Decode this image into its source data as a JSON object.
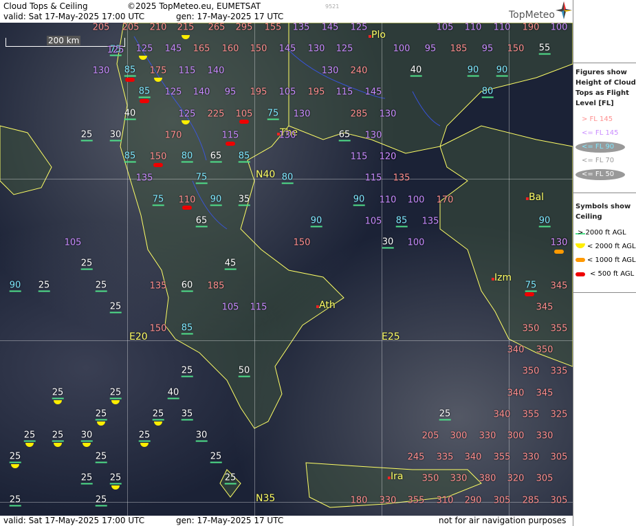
{
  "header": {
    "title": "Cloud Tops & Ceiling",
    "copyright": "©2025 TopMeteo.eu, EUMETSAT",
    "valid": "valid:  Sat  17-May-2025  17:00 UTC",
    "gen": "gen: 17-May-2025 17 UTC",
    "code": "9521",
    "logo": "TopMeteo"
  },
  "footer": {
    "valid": "valid:  Sat  17-May-2025  17:00 UTC",
    "gen": "gen: 17-May-2025 17 UTC",
    "note": "not for air navigation purposes"
  },
  "scale": "200 km",
  "grid_labels": {
    "n40": "N40",
    "n35": "N35",
    "e20": "E20",
    "e25": "E25"
  },
  "cities": [
    {
      "name": "Plo"
    },
    {
      "name": "The"
    },
    {
      "name": "Bal"
    },
    {
      "name": "Izm"
    },
    {
      "name": "Ath"
    },
    {
      "name": "Ira"
    }
  ],
  "legend": {
    "figures_title": [
      "Figures show",
      "Height of Cloud",
      "Tops as Flight",
      "Level  [FL]"
    ],
    "items": [
      {
        "label": "> FL 145",
        "color": "#ff8f8f"
      },
      {
        "label": "<= FL 145",
        "color": "#c98cff"
      },
      {
        "label": "<= FL 90",
        "color": "#7fe8ff"
      },
      {
        "label": "<= FL 70",
        "color": "#ffffff"
      },
      {
        "label": "<= FL 50",
        "color": "#ffffff"
      }
    ],
    "symbols_title": [
      "Symbols show",
      "Ceiling"
    ],
    "symbols": [
      {
        "label": "> 2000 ft AGL",
        "color": "#4fe08a"
      },
      {
        "label": "< 2000 ft AGL",
        "color": "#ffee00"
      },
      {
        "label": "< 1000 ft AGL",
        "color": "#ff9900"
      },
      {
        "label": "< 500 ft AGL",
        "color": "#ee0000"
      }
    ]
  },
  "labels": [
    {
      "t": "205",
      "c": "hi"
    },
    {
      "t": "205",
      "c": "hi"
    },
    {
      "t": "210",
      "c": "hi"
    },
    {
      "t": "215",
      "c": "hi"
    },
    {
      "t": "265",
      "c": "hi"
    },
    {
      "t": "295",
      "c": "hi"
    },
    {
      "t": "155",
      "c": "hi"
    },
    {
      "t": "135",
      "c": "mid"
    },
    {
      "t": "145",
      "c": "mid"
    },
    {
      "t": "125",
      "c": "mid"
    },
    {
      "t": "105",
      "c": "mid"
    },
    {
      "t": "110",
      "c": "mid"
    },
    {
      "t": "110",
      "c": "mid"
    },
    {
      "t": "190",
      "c": "hi"
    },
    {
      "t": "100",
      "c": "mid"
    },
    {
      "t": "75",
      "c": "low"
    },
    {
      "t": "125",
      "c": "mid"
    },
    {
      "t": "145",
      "c": "mid"
    },
    {
      "t": "165",
      "c": "hi"
    },
    {
      "t": "160",
      "c": "hi"
    },
    {
      "t": "150",
      "c": "hi"
    },
    {
      "t": "145",
      "c": "mid"
    },
    {
      "t": "130",
      "c": "mid"
    },
    {
      "t": "125",
      "c": "mid"
    },
    {
      "t": "100",
      "c": "mid"
    },
    {
      "t": "95",
      "c": "mid"
    },
    {
      "t": "185",
      "c": "hi"
    },
    {
      "t": "95",
      "c": "mid"
    },
    {
      "t": "150",
      "c": "hi"
    },
    {
      "t": "55",
      "c": "vlow"
    },
    {
      "t": "130",
      "c": "mid"
    },
    {
      "t": "85",
      "c": "low"
    },
    {
      "t": "175",
      "c": "hi"
    },
    {
      "t": "115",
      "c": "mid"
    },
    {
      "t": "140",
      "c": "mid"
    },
    {
      "t": "130",
      "c": "mid"
    },
    {
      "t": "240",
      "c": "hi"
    },
    {
      "t": "40",
      "c": "vlow"
    },
    {
      "t": "90",
      "c": "low"
    },
    {
      "t": "90",
      "c": "low"
    },
    {
      "t": "85",
      "c": "low"
    },
    {
      "t": "125",
      "c": "mid"
    },
    {
      "t": "140",
      "c": "mid"
    },
    {
      "t": "95",
      "c": "mid"
    },
    {
      "t": "195",
      "c": "hi"
    },
    {
      "t": "105",
      "c": "mid"
    },
    {
      "t": "195",
      "c": "hi"
    },
    {
      "t": "115",
      "c": "mid"
    },
    {
      "t": "145",
      "c": "mid"
    },
    {
      "t": "80",
      "c": "low"
    },
    {
      "t": "40",
      "c": "vlow"
    },
    {
      "t": "125",
      "c": "mid"
    },
    {
      "t": "225",
      "c": "hi"
    },
    {
      "t": "105",
      "c": "hi"
    },
    {
      "t": "75",
      "c": "low"
    },
    {
      "t": "130",
      "c": "mid"
    },
    {
      "t": "285",
      "c": "hi"
    },
    {
      "t": "130",
      "c": "mid"
    },
    {
      "t": "25",
      "c": "vlow"
    },
    {
      "t": "30",
      "c": "vlow"
    },
    {
      "t": "170",
      "c": "hi"
    },
    {
      "t": "115",
      "c": "mid"
    },
    {
      "t": "130",
      "c": "mid"
    },
    {
      "t": "65",
      "c": "vlow"
    },
    {
      "t": "130",
      "c": "mid"
    },
    {
      "t": "85",
      "c": "low"
    },
    {
      "t": "150",
      "c": "hi"
    },
    {
      "t": "80",
      "c": "low"
    },
    {
      "t": "65",
      "c": "vlow"
    },
    {
      "t": "85",
      "c": "low"
    },
    {
      "t": "115",
      "c": "mid"
    },
    {
      "t": "120",
      "c": "mid"
    },
    {
      "t": "135",
      "c": "mid"
    },
    {
      "t": "75",
      "c": "low"
    },
    {
      "t": "80",
      "c": "low"
    },
    {
      "t": "115",
      "c": "mid"
    },
    {
      "t": "135",
      "c": "hi"
    },
    {
      "t": "75",
      "c": "low"
    },
    {
      "t": "110",
      "c": "hi"
    },
    {
      "t": "90",
      "c": "low"
    },
    {
      "t": "35",
      "c": "vlow"
    },
    {
      "t": "90",
      "c": "low"
    },
    {
      "t": "110",
      "c": "mid"
    },
    {
      "t": "100",
      "c": "mid"
    },
    {
      "t": "170",
      "c": "hi"
    },
    {
      "t": "65",
      "c": "vlow"
    },
    {
      "t": "90",
      "c": "low"
    },
    {
      "t": "105",
      "c": "mid"
    },
    {
      "t": "85",
      "c": "low"
    },
    {
      "t": "135",
      "c": "mid"
    },
    {
      "t": "90",
      "c": "low"
    },
    {
      "t": "105",
      "c": "mid"
    },
    {
      "t": "150",
      "c": "hi"
    },
    {
      "t": "30",
      "c": "vlow"
    },
    {
      "t": "100",
      "c": "mid"
    },
    {
      "t": "130",
      "c": "hi"
    },
    {
      "t": "25",
      "c": "vlow"
    },
    {
      "t": "45",
      "c": "vlow"
    },
    {
      "t": "90",
      "c": "low"
    },
    {
      "t": "25",
      "c": "vlow"
    },
    {
      "t": "25",
      "c": "vlow"
    },
    {
      "t": "135",
      "c": "hi"
    },
    {
      "t": "60",
      "c": "vlow"
    },
    {
      "t": "185",
      "c": "hi"
    },
    {
      "t": "75",
      "c": "low"
    },
    {
      "t": "345",
      "c": "hi"
    },
    {
      "t": "25",
      "c": "vlow"
    },
    {
      "t": "105",
      "c": "mid"
    },
    {
      "t": "115",
      "c": "mid"
    },
    {
      "t": "345",
      "c": "hi"
    },
    {
      "t": "150",
      "c": "hi"
    },
    {
      "t": "85",
      "c": "low"
    },
    {
      "t": "350",
      "c": "hi"
    },
    {
      "t": "355",
      "c": "hi"
    },
    {
      "t": "340",
      "c": "hi"
    },
    {
      "t": "350",
      "c": "hi"
    },
    {
      "t": "25",
      "c": "vlow"
    },
    {
      "t": "50",
      "c": "vlow"
    },
    {
      "t": "350",
      "c": "hi"
    },
    {
      "t": "335",
      "c": "hi"
    },
    {
      "t": "25",
      "c": "vlow"
    },
    {
      "t": "25",
      "c": "vlow"
    },
    {
      "t": "40",
      "c": "vlow"
    },
    {
      "t": "340",
      "c": "hi"
    },
    {
      "t": "345",
      "c": "hi"
    },
    {
      "t": "25",
      "c": "vlow"
    },
    {
      "t": "25",
      "c": "vlow"
    },
    {
      "t": "35",
      "c": "vlow"
    },
    {
      "t": "25",
      "c": "vlow"
    },
    {
      "t": "340",
      "c": "hi"
    },
    {
      "t": "355",
      "c": "hi"
    },
    {
      "t": "325",
      "c": "hi"
    },
    {
      "t": "25",
      "c": "vlow"
    },
    {
      "t": "25",
      "c": "vlow"
    },
    {
      "t": "30",
      "c": "vlow"
    },
    {
      "t": "25",
      "c": "vlow"
    },
    {
      "t": "30",
      "c": "vlow"
    },
    {
      "t": "205",
      "c": "hi"
    },
    {
      "t": "300",
      "c": "hi"
    },
    {
      "t": "330",
      "c": "hi"
    },
    {
      "t": "300",
      "c": "hi"
    },
    {
      "t": "330",
      "c": "hi"
    },
    {
      "t": "25",
      "c": "vlow"
    },
    {
      "t": "25",
      "c": "vlow"
    },
    {
      "t": "25",
      "c": "vlow"
    },
    {
      "t": "245",
      "c": "hi"
    },
    {
      "t": "335",
      "c": "hi"
    },
    {
      "t": "340",
      "c": "hi"
    },
    {
      "t": "355",
      "c": "hi"
    },
    {
      "t": "330",
      "c": "hi"
    },
    {
      "t": "305",
      "c": "hi"
    },
    {
      "t": "25",
      "c": "vlow"
    },
    {
      "t": "25",
      "c": "vlow"
    },
    {
      "t": "25",
      "c": "vlow"
    },
    {
      "t": "350",
      "c": "hi"
    },
    {
      "t": "330",
      "c": "hi"
    },
    {
      "t": "380",
      "c": "hi"
    },
    {
      "t": "320",
      "c": "hi"
    },
    {
      "t": "305",
      "c": "hi"
    },
    {
      "t": "25",
      "c": "vlow"
    },
    {
      "t": "25",
      "c": "vlow"
    },
    {
      "t": "180",
      "c": "hi"
    },
    {
      "t": "330",
      "c": "hi"
    },
    {
      "t": "355",
      "c": "hi"
    },
    {
      "t": "310",
      "c": "hi"
    },
    {
      "t": "290",
      "c": "hi"
    },
    {
      "t": "305",
      "c": "hi"
    },
    {
      "t": "285",
      "c": "hi"
    },
    {
      "t": "305",
      "c": "hi"
    },
    {
      "t": "130",
      "c": "mid"
    },
    {
      "t": "125",
      "c": "mid"
    },
    {
      "t": "120",
      "c": "mid"
    }
  ]
}
